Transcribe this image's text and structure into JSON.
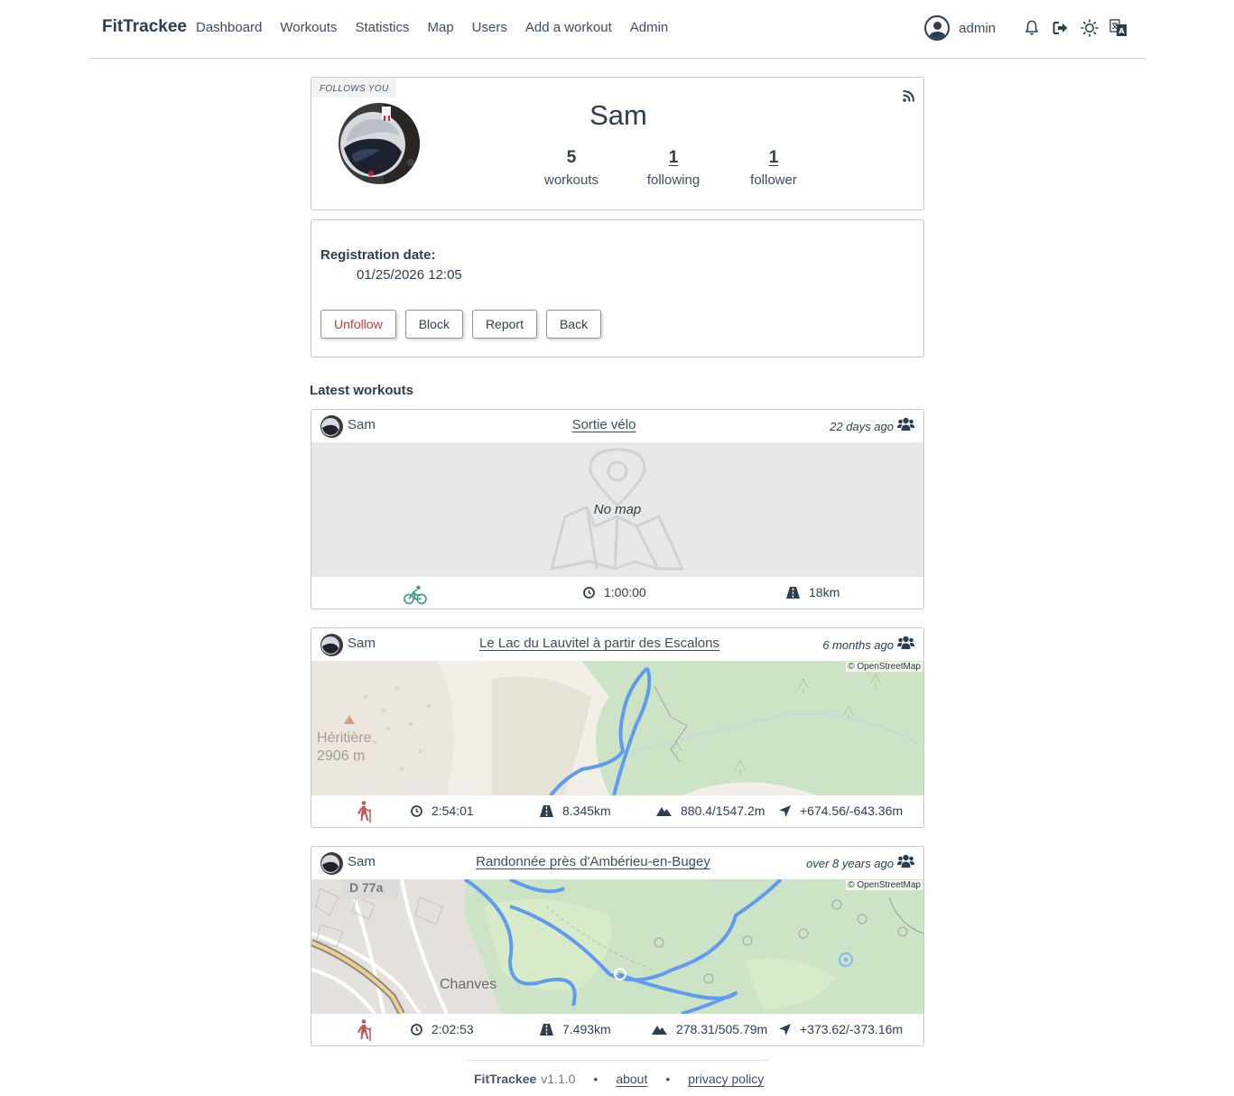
{
  "nav": {
    "brand": "FitTrackee",
    "links": [
      "Dashboard",
      "Workouts",
      "Statistics",
      "Map",
      "Users",
      "Add a workout",
      "Admin"
    ],
    "user": "admin"
  },
  "profile": {
    "follows_badge": "FOLLOWS YOU",
    "username": "Sam",
    "stats": [
      {
        "value": "5",
        "label": "workouts"
      },
      {
        "value": "1",
        "label": "following"
      },
      {
        "value": "1",
        "label": "follower"
      }
    ]
  },
  "info": {
    "registration_label": "Registration date:",
    "registration_value": "01/25/2026 12:05",
    "buttons": {
      "unfollow": "Unfollow",
      "block": "Block",
      "report": "Report",
      "back": "Back"
    }
  },
  "section_title": "Latest workouts",
  "workouts": [
    {
      "user": "Sam",
      "title": "Sortie vélo",
      "date": "22 days ago",
      "no_map": "No map",
      "sport_icon": "cycling-icon",
      "duration": "1:00:00",
      "distance": "18km"
    },
    {
      "user": "Sam",
      "title": "Le Lac du Lauvitel à partir des Escalons",
      "date": "6 months ago",
      "attribution": "© OpenStreetMap",
      "map_label_1": "Héritière",
      "map_label_2": "2906 m",
      "sport_icon": "hiking-icon",
      "duration": "2:54:01",
      "distance": "8.345km",
      "elevation": "880.4/1547.2m",
      "ascent_descent": "+674.56/-643.36m"
    },
    {
      "user": "Sam",
      "title": "Randonnée près d'Ambérieu-en-Bugey",
      "date": "over 8 years ago",
      "attribution": "© OpenStreetMap",
      "map_road": "D 77a",
      "map_town": "Chanves",
      "sport_icon": "hiking-icon",
      "duration": "2:02:53",
      "distance": "7.493km",
      "elevation": "278.31/505.79m",
      "ascent_descent": "+373.62/-373.16m"
    }
  ],
  "footer": {
    "brand": "FitTrackee",
    "version": "v1.1.0",
    "about": "about",
    "privacy": "privacy policy"
  },
  "colors": {
    "text": "#2c3e50",
    "danger": "#d03737",
    "route": "#3d8bfd",
    "cycling": "#4a9a8a",
    "hiking": "#c0585a"
  }
}
